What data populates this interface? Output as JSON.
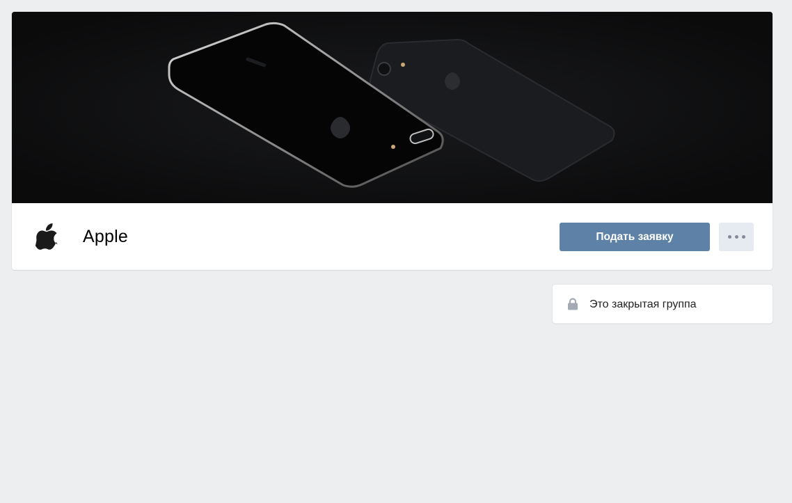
{
  "group": {
    "name": "Apple",
    "apply_label": "Подать заявку",
    "more_icon": "ellipsis-icon",
    "avatar_icon": "apple-logo-icon"
  },
  "sidebar": {
    "closed_group_text": "Это закрытая группа",
    "closed_group_icon": "lock-icon"
  },
  "colors": {
    "page_background": "#edeef0",
    "primary_button": "#5e81a8",
    "secondary_button": "#e5ebf1",
    "cover_background": "#0b0b0c"
  }
}
